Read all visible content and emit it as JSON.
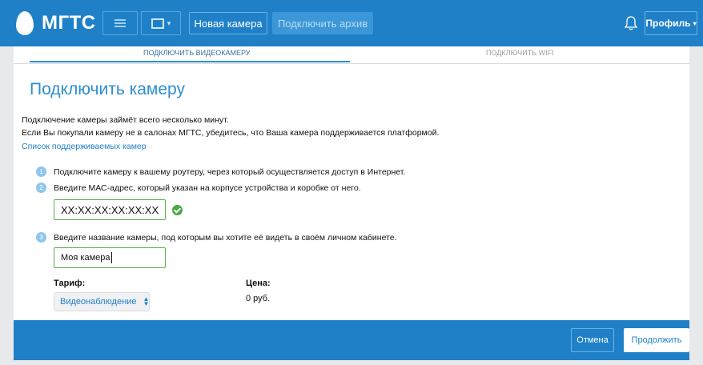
{
  "app": {
    "logo_text": "МГТС"
  },
  "topbar": {
    "new_camera": "Новая камера",
    "connect_archive": "Подключить архив",
    "profile": "Профиль"
  },
  "subtabs": {
    "connect_camera": "подключить видеокамеру",
    "connect_wifi": "подключить wifi"
  },
  "form": {
    "title": "Подключить камеру",
    "intro_line1": "Подключение камеры займёт всего несколько минут.",
    "intro_line2": "Если Вы покупали камеру не в салонах МГТС, убедитесь, что Ваша камера поддерживается платформой.",
    "supported_link": "Список поддерживаемых камер",
    "steps": [
      {
        "num": "1",
        "text": "Подключите камеру к вашему роутеру, через который осуществляется доступ в Интернет."
      },
      {
        "num": "2",
        "text": "Введите МАС-адрес, который указан на корпусе устройства и коробке от него."
      },
      {
        "num": "3",
        "text": "Введите название камеры, под которым вы хотите её видеть в своём личном кабинете."
      }
    ],
    "mac_value": "XX:XX:XX:XX:XX:XX",
    "camera_name_value": "Моя камера",
    "tariff_label": "Тариф:",
    "tariff_selected": "Видеонаблюдение",
    "price_label": "Цена:",
    "price_value": "0 руб."
  },
  "footer": {
    "cancel": "Отмена",
    "continue": "Продолжить"
  },
  "colors": {
    "brand_blue": "#1f80c8",
    "accent_blue": "#2d8ed3",
    "valid_green": "#57b04a"
  },
  "icons": [
    "menu-icon",
    "view-icon",
    "bell-icon",
    "check-icon",
    "select-arrows-icon"
  ]
}
